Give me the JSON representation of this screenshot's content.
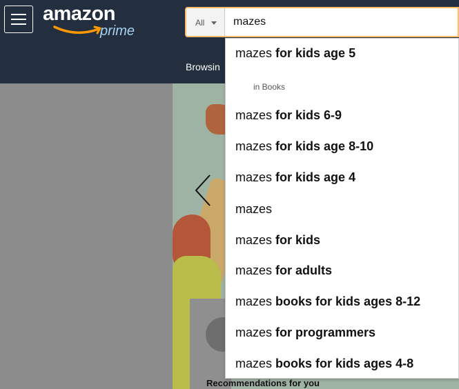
{
  "header": {
    "logo_word": "amazon",
    "logo_prime": "prime",
    "browsing_text": "Browsin"
  },
  "search": {
    "department": "All",
    "query": "mazes"
  },
  "suggestions": [
    {
      "prefix": "mazes",
      "suffix": "for kids age 5"
    },
    {
      "prefix": "mazes",
      "suffix": "for kids 6-9"
    },
    {
      "prefix": "mazes",
      "suffix": "for kids age 8-10"
    },
    {
      "prefix": "mazes",
      "suffix": "for kids age 4"
    },
    {
      "prefix": "mazes",
      "suffix": ""
    },
    {
      "prefix": "mazes",
      "suffix": "for kids"
    },
    {
      "prefix": "mazes",
      "suffix": "for adults"
    },
    {
      "prefix": "mazes",
      "suffix": "books for kids ages 8-12"
    },
    {
      "prefix": "mazes",
      "suffix": "for programmers"
    },
    {
      "prefix": "mazes",
      "suffix": "books for kids ages 4-8"
    }
  ],
  "suggestion_sub": "in Books",
  "recommendations_label": "Recommendations for you",
  "colors": {
    "header_bg": "#232f3e",
    "search_border": "#febd69",
    "prime_blue": "#a7d2f0"
  }
}
